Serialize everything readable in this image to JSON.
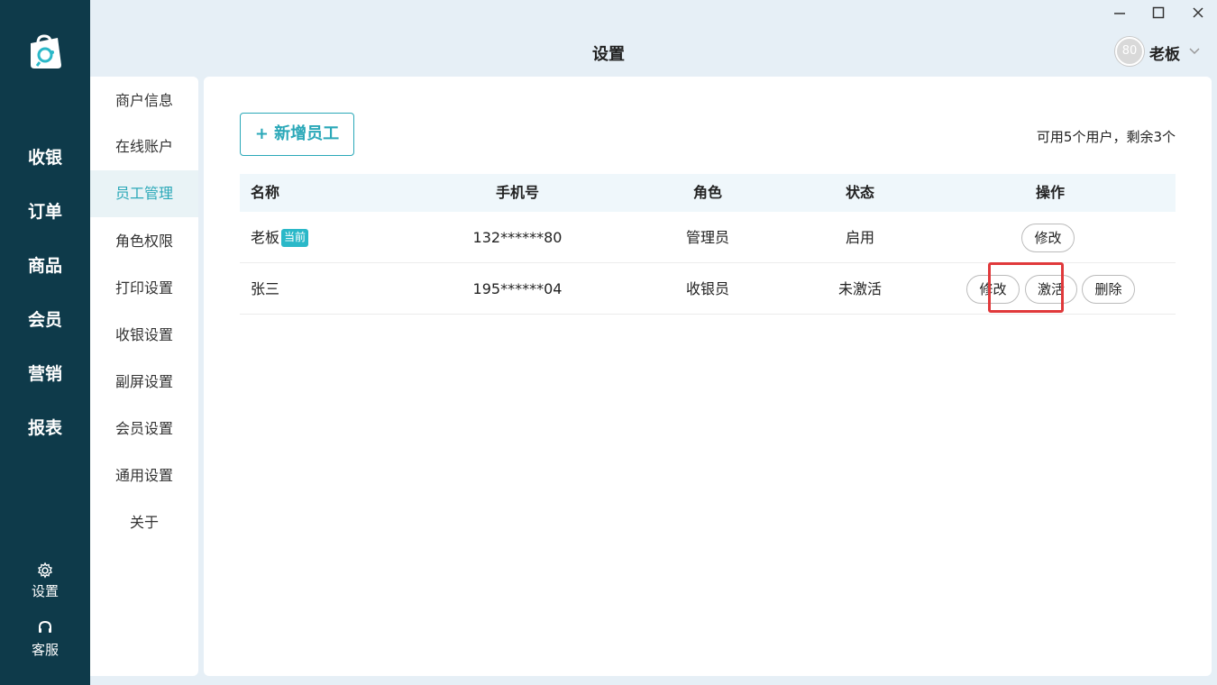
{
  "app": {
    "title": "设置",
    "window_controls": [
      "minimize",
      "maximize",
      "close"
    ],
    "user": {
      "avatar_text": "80",
      "name": "老板"
    }
  },
  "leftnav": {
    "items": [
      {
        "label": "收银"
      },
      {
        "label": "订单"
      },
      {
        "label": "商品"
      },
      {
        "label": "会员"
      },
      {
        "label": "营销"
      },
      {
        "label": "报表"
      }
    ],
    "bottom": [
      {
        "label": "设置",
        "icon": "gear-icon"
      },
      {
        "label": "客服",
        "icon": "headset-icon"
      }
    ]
  },
  "submenu": {
    "items": [
      {
        "label": "商户信息"
      },
      {
        "label": "在线账户"
      },
      {
        "label": "员工管理",
        "active": true
      },
      {
        "label": "角色权限"
      },
      {
        "label": "打印设置"
      },
      {
        "label": "收银设置"
      },
      {
        "label": "副屏设置"
      },
      {
        "label": "会员设置"
      },
      {
        "label": "通用设置"
      },
      {
        "label": "关于"
      }
    ]
  },
  "main": {
    "add_button": "+ 新增员工",
    "quota_text": "可用5个用户，剩余3个",
    "table": {
      "headers": [
        "名称",
        "手机号",
        "角色",
        "状态",
        "操作"
      ],
      "rows": [
        {
          "name": "老板",
          "badge": "当前",
          "phone": "132******80",
          "role": "管理员",
          "status": "启用",
          "actions": [
            "修改"
          ]
        },
        {
          "name": "张三",
          "phone": "195******04",
          "role": "收银员",
          "status": "未激活",
          "actions": [
            "修改",
            "激活",
            "删除"
          ]
        }
      ]
    }
  },
  "colors": {
    "nav_bg": "#0e3a4a",
    "accent": "#2aa8b8",
    "highlight": "#e0393b",
    "page_bg": "#e6eff6"
  }
}
